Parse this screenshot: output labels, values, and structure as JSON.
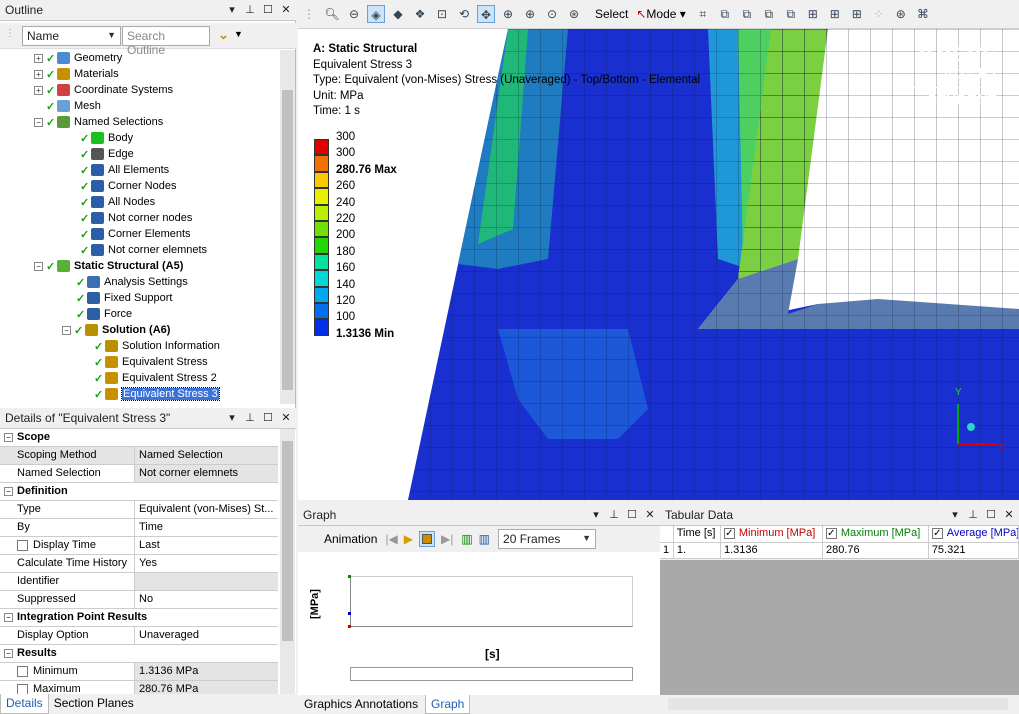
{
  "outline": {
    "title": "Outline",
    "filter_value": "Name",
    "search_placeholder": "Search Outline",
    "tree": [
      {
        "label": "Geometry",
        "indent": 1
      },
      {
        "label": "Materials",
        "indent": 1
      },
      {
        "label": "Coordinate Systems",
        "indent": 1
      },
      {
        "label": "Mesh",
        "indent": 1
      },
      {
        "label": "Named Selections",
        "indent": 1
      },
      {
        "label": "Body",
        "indent": 2
      },
      {
        "label": "Edge",
        "indent": 2
      },
      {
        "label": "All Elements",
        "indent": 2
      },
      {
        "label": "Corner Nodes",
        "indent": 2
      },
      {
        "label": "All Nodes",
        "indent": 2
      },
      {
        "label": "Not corner nodes",
        "indent": 2
      },
      {
        "label": "Corner Elements",
        "indent": 2
      },
      {
        "label": "Not corner elemnets",
        "indent": 2
      },
      {
        "label": "Static Structural (A5)",
        "indent": 0
      },
      {
        "label": "Analysis Settings",
        "indent": 1
      },
      {
        "label": "Fixed Support",
        "indent": 1
      },
      {
        "label": "Force",
        "indent": 1
      },
      {
        "label": "Solution (A6)",
        "indent": 1
      },
      {
        "label": "Solution Information",
        "indent": 2
      },
      {
        "label": "Equivalent Stress",
        "indent": 2
      },
      {
        "label": "Equivalent Stress 2",
        "indent": 2
      },
      {
        "label": "Equivalent Stress 3",
        "indent": 2
      }
    ]
  },
  "details": {
    "title": "Details of \"Equivalent Stress 3\"",
    "groups": {
      "scope": "Scope",
      "definition": "Definition",
      "integration": "Integration Point Results",
      "results": "Results"
    },
    "rows": {
      "scoping_method": [
        "Scoping Method",
        "Named Selection"
      ],
      "named_selection": [
        "Named Selection",
        "Not corner elemnets"
      ],
      "type": [
        "Type",
        "Equivalent (von-Mises) St..."
      ],
      "by": [
        "By",
        "Time"
      ],
      "display_time": [
        "Display Time",
        "Last"
      ],
      "calc_time_history": [
        "Calculate Time History",
        "Yes"
      ],
      "identifier": [
        "Identifier",
        ""
      ],
      "suppressed": [
        "Suppressed",
        "No"
      ],
      "display_option": [
        "Display Option",
        "Unaveraged"
      ],
      "minimum": [
        "Minimum",
        "1.3136 MPa"
      ],
      "maximum": [
        "Maximum",
        "280.76 MPa"
      ]
    }
  },
  "left_tabs": {
    "details": "Details",
    "section_planes": "Section Planes"
  },
  "toolbar": {
    "select": "Select",
    "mode": "Mode"
  },
  "viewport": {
    "header": {
      "title": "A: Static Structural",
      "name": "Equivalent Stress 3",
      "type": "Type: Equivalent (von-Mises) Stress (Unaveraged) - Top/Bottom - Elemental",
      "unit": "Unit: MPa",
      "time": "Time: 1 s"
    },
    "legend": {
      "labels": [
        "300",
        "300",
        "280.76 Max",
        "260",
        "240",
        "220",
        "200",
        "180",
        "160",
        "140",
        "120",
        "100",
        "1.3136 Min"
      ],
      "colors": [
        "#e00000",
        "#f07000",
        "#f8c800",
        "#e8f000",
        "#b8f000",
        "#70e000",
        "#20d800",
        "#00e0a0",
        "#00d8d8",
        "#00a8f0",
        "#0070f0",
        "#0030e8"
      ]
    },
    "brand": {
      "name": "Ansys",
      "version": "2021 R2",
      "edition": "STUDENT"
    },
    "triad": {
      "x": "X",
      "y": "Y"
    }
  },
  "graph": {
    "title": "Graph",
    "animation_label": "Animation",
    "frames": "20 Frames",
    "ylabel": "[MPa]",
    "xlabel": "[s]"
  },
  "tabular": {
    "title": "Tabular Data",
    "headers": [
      "Time [s]",
      "Minimum [MPa]",
      "Maximum [MPa]",
      "Average [MPa]"
    ],
    "header_colors": [
      "#000000",
      "#c00000",
      "#008000",
      "#0000c0"
    ],
    "rows": [
      [
        "1",
        "1.",
        "1.3136",
        "280.76",
        "75.321"
      ]
    ]
  },
  "bottom_tabs": {
    "annotations": "Graphics Annotations",
    "graph": "Graph"
  }
}
